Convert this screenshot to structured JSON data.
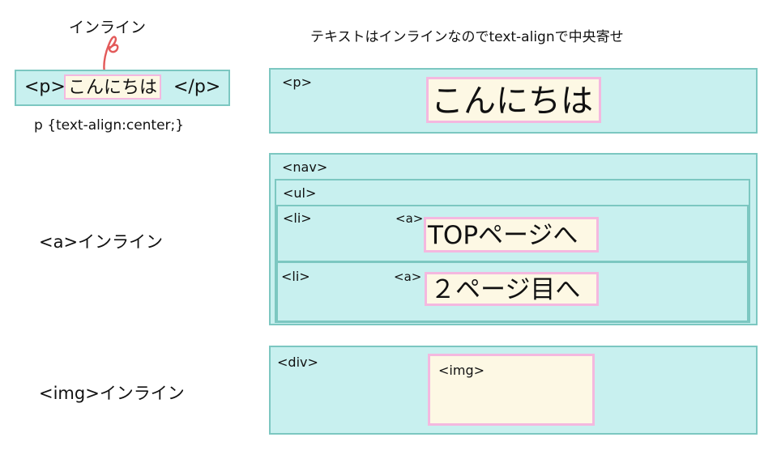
{
  "colors": {
    "block_fill": "#c8f0ef",
    "block_border": "#7cc7c1",
    "inline_fill": "#fdf8e4",
    "inline_border": "#f4b8df",
    "arrow": "#e35a5a"
  },
  "left": {
    "inline_label": "インライン",
    "p_open": "<p>",
    "p_text": "こんにちは",
    "p_close": "</p>",
    "p_css": "p {text-align:center;}",
    "a_note": "<a>インライン",
    "img_note": "<img>インライン"
  },
  "header": "テキストはインラインなのでtext-alignで中央寄せ",
  "p_block": {
    "tag": "<p>",
    "text": "こんにちは"
  },
  "nav_block": {
    "nav_tag": "<nav>",
    "ul_tag": "<ul>",
    "items": [
      {
        "li_tag": "<li>",
        "a_tag": "<a>",
        "text": "TOPページへ"
      },
      {
        "li_tag": "<li>",
        "a_tag": "<a>",
        "text": "２ページ目へ"
      }
    ]
  },
  "div_block": {
    "div_tag": "<div>",
    "img_tag": "<img>"
  }
}
